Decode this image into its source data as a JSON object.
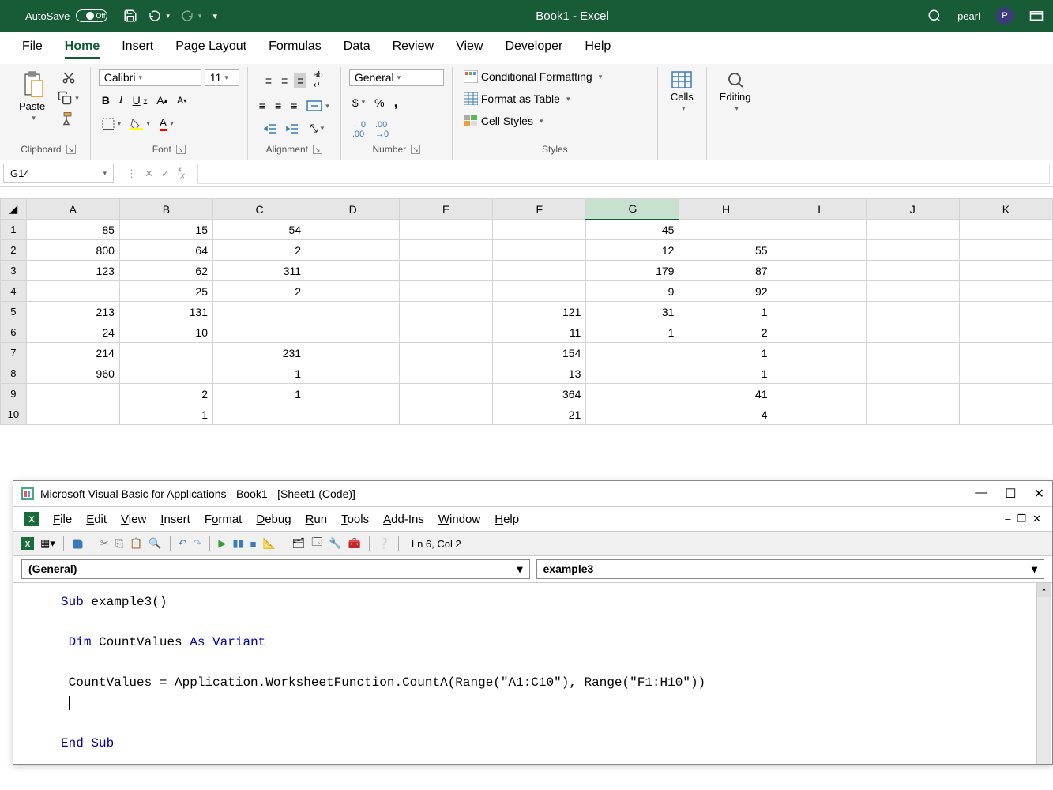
{
  "title_bar": {
    "autosave_label": "AutoSave",
    "autosave_state": "Off",
    "document_title": "Book1 - Excel",
    "user_name": "pearl",
    "user_initial": "P"
  },
  "ribbon": {
    "tabs": [
      "File",
      "Home",
      "Insert",
      "Page Layout",
      "Formulas",
      "Data",
      "Review",
      "View",
      "Developer",
      "Help"
    ],
    "active_tab": "Home",
    "clipboard": {
      "paste_label": "Paste",
      "group_label": "Clipboard"
    },
    "font": {
      "name": "Calibri",
      "size": "11",
      "group_label": "Font"
    },
    "alignment": {
      "group_label": "Alignment"
    },
    "number": {
      "format": "General",
      "group_label": "Number"
    },
    "styles": {
      "cond_fmt": "Conditional Formatting",
      "format_table": "Format as Table",
      "cell_styles": "Cell Styles",
      "group_label": "Styles"
    },
    "cells": {
      "label": "Cells"
    },
    "editing": {
      "label": "Editing"
    }
  },
  "formula_bar": {
    "name_box": "G14",
    "formula": ""
  },
  "sheet": {
    "columns": [
      "A",
      "B",
      "C",
      "D",
      "E",
      "F",
      "G",
      "H",
      "I",
      "J",
      "K"
    ],
    "active_col": "G",
    "rows": [
      {
        "r": "1",
        "A": "85",
        "B": "15",
        "C": "54",
        "G": "45"
      },
      {
        "r": "2",
        "A": "800",
        "B": "64",
        "C": "2",
        "G": "12",
        "H": "55"
      },
      {
        "r": "3",
        "A": "123",
        "B": "62",
        "C": "311",
        "G": "179",
        "H": "87"
      },
      {
        "r": "4",
        "B": "25",
        "C": "2",
        "G": "9",
        "H": "92"
      },
      {
        "r": "5",
        "A": "213",
        "B": "131",
        "F": "121",
        "G": "31",
        "H": "1"
      },
      {
        "r": "6",
        "A": "24",
        "B": "10",
        "F": "11",
        "G": "1",
        "H": "2"
      },
      {
        "r": "7",
        "A": "214",
        "C": "231",
        "F": "154",
        "H": "1"
      },
      {
        "r": "8",
        "A": "960",
        "C": "1",
        "F": "13",
        "H": "1"
      },
      {
        "r": "9",
        "B": "2",
        "C": "1",
        "F": "364",
        "H": "41"
      },
      {
        "r": "10",
        "B": "1",
        "F": "21",
        "H": "4"
      }
    ]
  },
  "vba": {
    "window_title": "Microsoft Visual Basic for Applications - Book1 - [Sheet1 (Code)]",
    "menus": [
      "File",
      "Edit",
      "View",
      "Insert",
      "Format",
      "Debug",
      "Run",
      "Tools",
      "Add-Ins",
      "Window",
      "Help"
    ],
    "status": "Ln 6, Col 2",
    "dropdown_left": "(General)",
    "dropdown_right": "example3",
    "code": {
      "line1": "Sub example3()",
      "line2_dim": "Dim",
      "line2_var": " CountValues  ",
      "line2_as": "As Variant",
      "line3": "CountValues = Application.WorksheetFunction.CountA(Range(\"A1:C10\"), Range(\"F1:H10\"))",
      "line4": "End Sub"
    }
  }
}
